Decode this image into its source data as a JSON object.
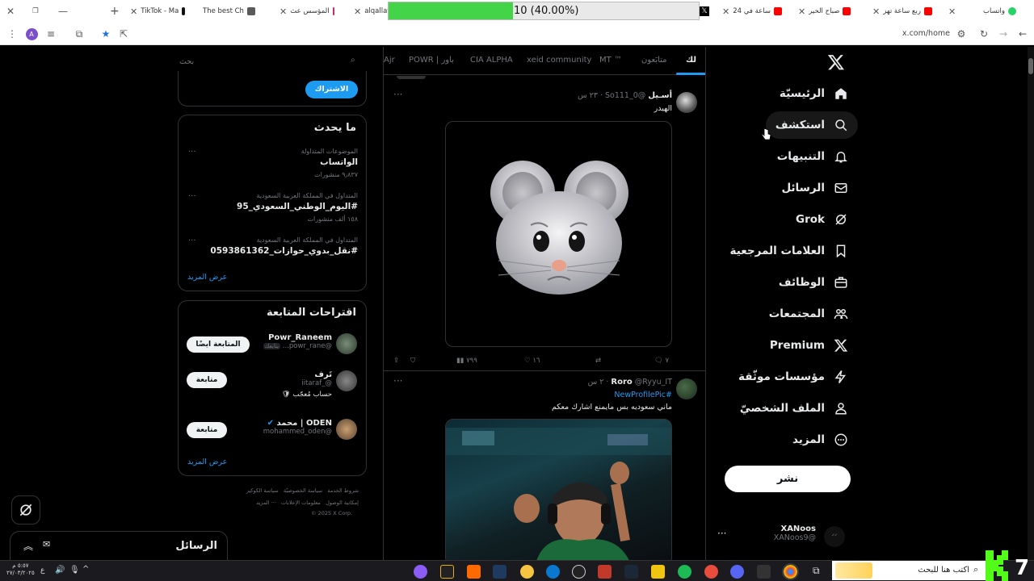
{
  "browser": {
    "tabs": [
      {
        "title": "واتساب",
        "color": "#25d366"
      },
      {
        "title": "ربع ساعة تهز",
        "color": "#ff0000"
      },
      {
        "title": "صباح الخير",
        "color": "#ff0000"
      },
      {
        "title": "24 ساعة في",
        "color": "#ff0000"
      },
      {
        "title": "alqallaf St",
        "color": "#888888"
      },
      {
        "title": "المؤسس عث",
        "color": "#cc2a6b"
      },
      {
        "title": "The best Ch",
        "color": "#5a5a5a"
      },
      {
        "title": "TikTok - Ma",
        "color": "#111111"
      }
    ],
    "progress": {
      "text": "10 (40.00%)",
      "fraction": 0.4
    },
    "url": "x.com/home",
    "profile_initial": "A"
  },
  "nav": {
    "items": [
      {
        "label": "الرئيسيّة",
        "icon": "home-icon"
      },
      {
        "label": "استكشف",
        "icon": "search-icon"
      },
      {
        "label": "التنبيهات",
        "icon": "bell-icon"
      },
      {
        "label": "الرسائل",
        "icon": "mail-icon"
      },
      {
        "label": "Grok",
        "icon": "grok-icon"
      },
      {
        "label": "العلامات المرجعية",
        "icon": "bookmark-icon"
      },
      {
        "label": "الوظائف",
        "icon": "briefcase-icon"
      },
      {
        "label": "المجتمعات",
        "icon": "people-icon"
      },
      {
        "label": "Premium",
        "icon": "x-logo-icon"
      },
      {
        "label": "مؤسسات موثّقة",
        "icon": "lightning-icon"
      },
      {
        "label": "الملف الشخصيّ",
        "icon": "person-icon"
      },
      {
        "label": "المزيد",
        "icon": "more-circle-icon"
      }
    ],
    "post_label": "نشر",
    "account": {
      "name": "XANoos",
      "handle": "@XANoos9"
    }
  },
  "feed": {
    "tabs": [
      "لك",
      "متابَعون",
      "MT ™",
      "xeid community",
      "CIA ALPHA",
      "باور | POWR",
      "Ajr"
    ],
    "tweets": [
      {
        "name": "أسـيل",
        "handle": "@So111_0",
        "time": "٢٣ س",
        "text": "الهيدر",
        "stats": {
          "replies": "٧",
          "likes": "١٦",
          "views": "٧٩٩"
        }
      },
      {
        "name": "Roro",
        "handle": "@Ryyu_IT",
        "time": "٢ س",
        "hashtag": "#NewProfilePic",
        "text": "ماني سعوديه بس مايمنع اشارك معكم"
      }
    ]
  },
  "sidebar": {
    "search_placeholder": "بحث",
    "subscribe_label": "الاشتراك",
    "trends_title": "ما يحدث",
    "trends": [
      {
        "meta": "الموضوعات المتداولة",
        "title": "الواتساب",
        "count": "٩٫٨٣٧ منشورات"
      },
      {
        "meta": "المتداول في المملكة العربية السعودية",
        "title": "#اليوم_الوطني_السعودي_95",
        "count": "١٥٨ ألف منشورات"
      },
      {
        "meta": "المتداول في المملكة العربية السعودية",
        "title": "#نقل_بدوي_حوازات_0593861362",
        "count": ""
      }
    ],
    "show_more": "عرض المزيد",
    "follow_title": "اقتراحات المتابعة",
    "suggestions": [
      {
        "name": "Powr_Raneem",
        "handle": "@powr_rane...",
        "badge": "يتابعك",
        "button": "المتابعة ايضًا",
        "bio": ""
      },
      {
        "name": "تَرف",
        "handle": "@_iitaraf",
        "badge": "",
        "button": "متابعة",
        "bio": "حساب مُعجّب 🛡"
      },
      {
        "name": "ODEN | محمد",
        "handle": "@mohammed_oden",
        "badge": "",
        "button": "متابعة",
        "bio": ""
      }
    ],
    "footer": {
      "line1": [
        "شروط الخدمة",
        "سياسة الخصوصيّة",
        "سياسة الكوكيز"
      ],
      "line2": [
        "إمكانية الوصول",
        "معلومات الإعلانات",
        "··· المزيد"
      ],
      "copyright": "© 2025 X Corp."
    }
  },
  "messages_drawer": {
    "title": "الرسائل"
  },
  "taskbar": {
    "search_placeholder": "اكتب هنا للبحث",
    "time": "٥:٥٧ م",
    "date": "٢٧/٠٣/٢٠٢٥",
    "lang": "ع"
  },
  "colors": {
    "accent": "#1d9bf0",
    "border": "#2f3336",
    "muted": "#71767b"
  }
}
